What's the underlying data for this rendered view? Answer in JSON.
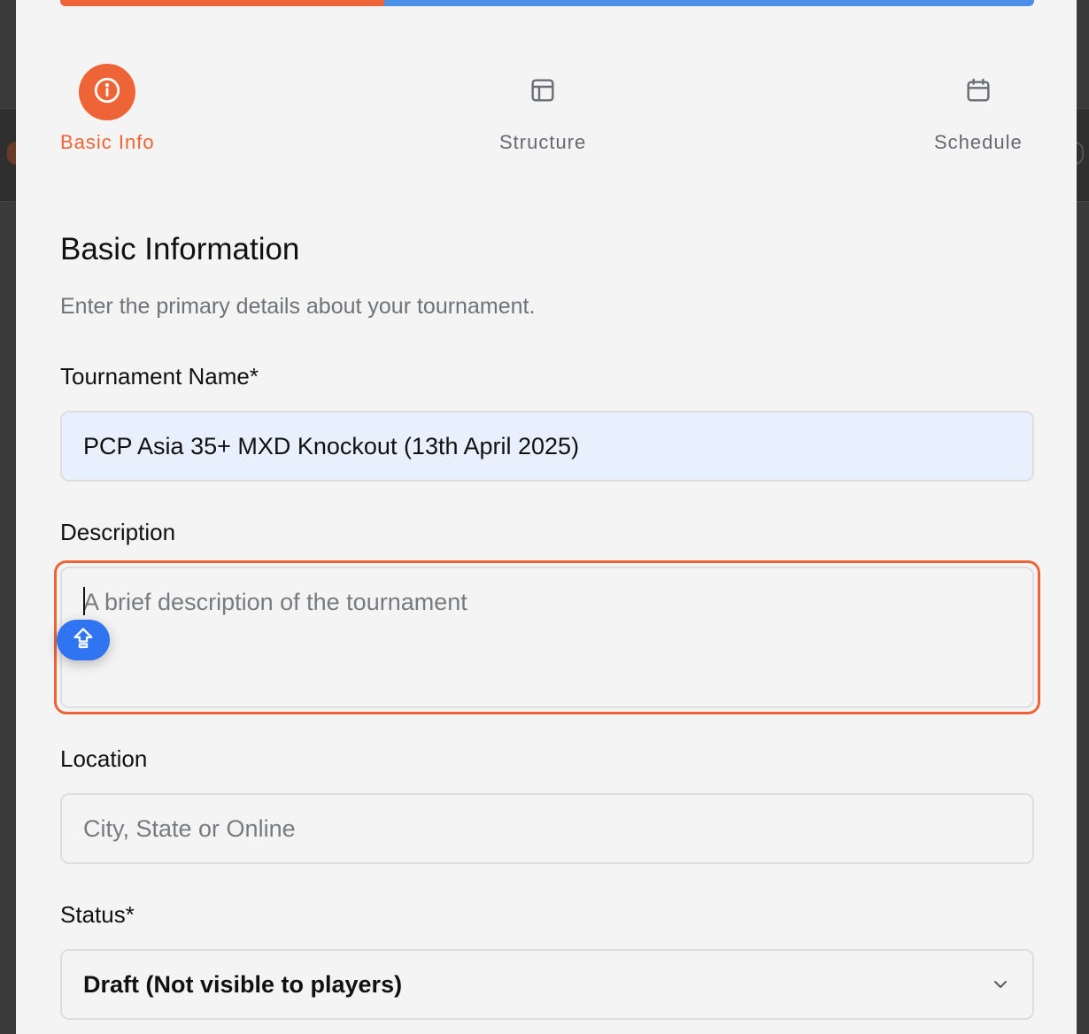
{
  "progress": {
    "completed_fraction": 0.333
  },
  "steps": [
    {
      "label": "Basic Info",
      "icon": "info-icon",
      "active": true
    },
    {
      "label": "Structure",
      "icon": "layout-icon",
      "active": false
    },
    {
      "label": "Schedule",
      "icon": "calendar-icon",
      "active": false
    }
  ],
  "section": {
    "title": "Basic Information",
    "subtitle": "Enter the primary details about your tournament."
  },
  "form": {
    "name_label": "Tournament Name*",
    "name_value": "PCP Asia 35+ MXD Knockout (13th April 2025)",
    "description_label": "Description",
    "description_placeholder": "A brief description of the tournament",
    "location_label": "Location",
    "location_placeholder": "City, State or Online",
    "status_label": "Status*",
    "status_value": "Draft (Not visible to players)"
  },
  "floating_button": {
    "icon": "shift-arrow-icon"
  },
  "colors": {
    "accent": "#ee6436",
    "progress_remaining": "#4a90e8",
    "name_field_bg": "#e8f0fd",
    "floating_button": "#2f74f0"
  }
}
